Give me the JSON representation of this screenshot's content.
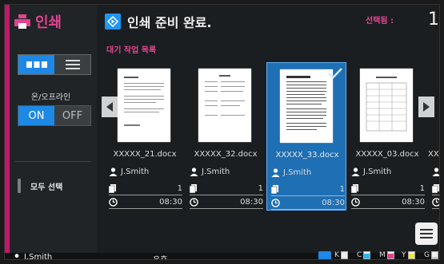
{
  "app": {
    "title": "인쇄"
  },
  "sidebar": {
    "online_label": "온/오프라인",
    "on_label": "ON",
    "off_label": "OFF",
    "select_all_label": "모두 선택"
  },
  "header": {
    "title": "인쇄 준비 완료.",
    "selected_label": "선택됨 :",
    "selected_count": "1"
  },
  "queue": {
    "label": "대기 작업 목록",
    "jobs": [
      {
        "file": "XXXXX_21.docx",
        "owner": "J.Smith",
        "copies": "1",
        "time": "08:30"
      },
      {
        "file": "XXXXX_32.docx",
        "owner": "J.Smith",
        "copies": "1",
        "time": "08:30"
      },
      {
        "file": "XXXXX_33.docx",
        "owner": "J.Smith",
        "copies": "1",
        "time": "08:30"
      },
      {
        "file": "XXXXX_03.docx",
        "owner": "J.Smith",
        "copies": "1",
        "time": "08:30"
      },
      {
        "file": "XX",
        "owner": "J.",
        "copies": "",
        "time": ""
      }
    ]
  },
  "statusbar": {
    "user": "J.Smith",
    "state": "유휴",
    "ink": [
      {
        "name": "K",
        "color": "#111111",
        "level": 0.0
      },
      {
        "name": "C",
        "color": "#29b6f6",
        "level": 0.7
      },
      {
        "name": "M",
        "color": "#e2438f",
        "level": 0.7
      },
      {
        "name": "Y",
        "color": "#f5e63b",
        "level": 0.7
      },
      {
        "name": "G",
        "color": "#cccccc",
        "level": 0.2
      }
    ]
  },
  "colors": {
    "accent": "#1e88e5",
    "brand": "#e2438f"
  }
}
